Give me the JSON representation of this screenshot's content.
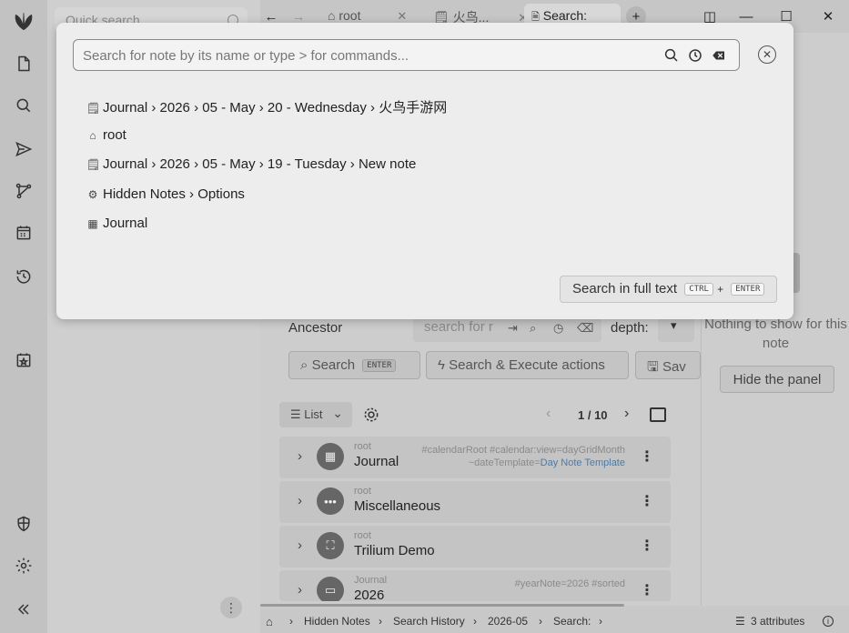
{
  "tree": {
    "quick_search_placeholder": "Quick search"
  },
  "tabs": [
    {
      "label": "root"
    },
    {
      "label": "火鸟..."
    },
    {
      "label": "Search:"
    }
  ],
  "search_form": {
    "ancestor_label": "Ancestor",
    "ancestor_placeholder": "search for r",
    "depth_label": "depth:",
    "search_button": "Search",
    "search_button_key": "ENTER",
    "execute_button": "Search & Execute actions",
    "save_button": "Sav"
  },
  "list_view": {
    "view_type": "List",
    "pager": "1 / 10"
  },
  "results": [
    {
      "parent": "root",
      "title": "Journal",
      "icon": "calendar-icon",
      "attrs_line1": "#calendarRoot #calendar:view=dayGridMonth",
      "attrs_line2_prefix": "~dateTemplate=",
      "attrs_line2_link": "Day Note Template"
    },
    {
      "parent": "root",
      "title": "Miscellaneous",
      "icon": "dots-icon",
      "attrs_line1": "",
      "attrs_line2_prefix": "",
      "attrs_line2_link": ""
    },
    {
      "parent": "root",
      "title": "Trilium Demo",
      "icon": "book-icon",
      "attrs_line1": "",
      "attrs_line2_prefix": "",
      "attrs_line2_link": ""
    },
    {
      "parent": "Journal",
      "title": "2026",
      "icon": "folder-icon",
      "attrs_line1": "#yearNote=2026 #sorted",
      "attrs_line2_prefix": "",
      "attrs_line2_link": ""
    }
  ],
  "right_panel": {
    "empty_text": "Nothing to show for this note",
    "hide_button": "Hide the panel"
  },
  "status_bar": {
    "crumbs": [
      "Hidden Notes",
      "Search History",
      "2026-05",
      "Search:"
    ],
    "attributes": "3 attributes"
  },
  "modal": {
    "placeholder": "Search for note by its name or type > for commands...",
    "results": [
      {
        "icon": "note-icon",
        "path": "Journal › 2026 › 05 - May › 20 - Wednesday › 火鸟手游网"
      },
      {
        "icon": "home-icon",
        "path": "root"
      },
      {
        "icon": "note-icon",
        "path": "Journal › 2026 › 05 - May › 19 - Tuesday › New note"
      },
      {
        "icon": "gear-icon",
        "path": "Hidden Notes › Options"
      },
      {
        "icon": "calendar-icon",
        "path": "Journal"
      }
    ],
    "fulltext_label": "Search in full text",
    "fulltext_key1": "CTRL",
    "fulltext_plus": "+",
    "fulltext_key2": "ENTER"
  },
  "colors": {
    "accent_link": "#4a7ba8",
    "modal_bg": "#ededed",
    "overlay_bg": "#c9c9c9"
  }
}
